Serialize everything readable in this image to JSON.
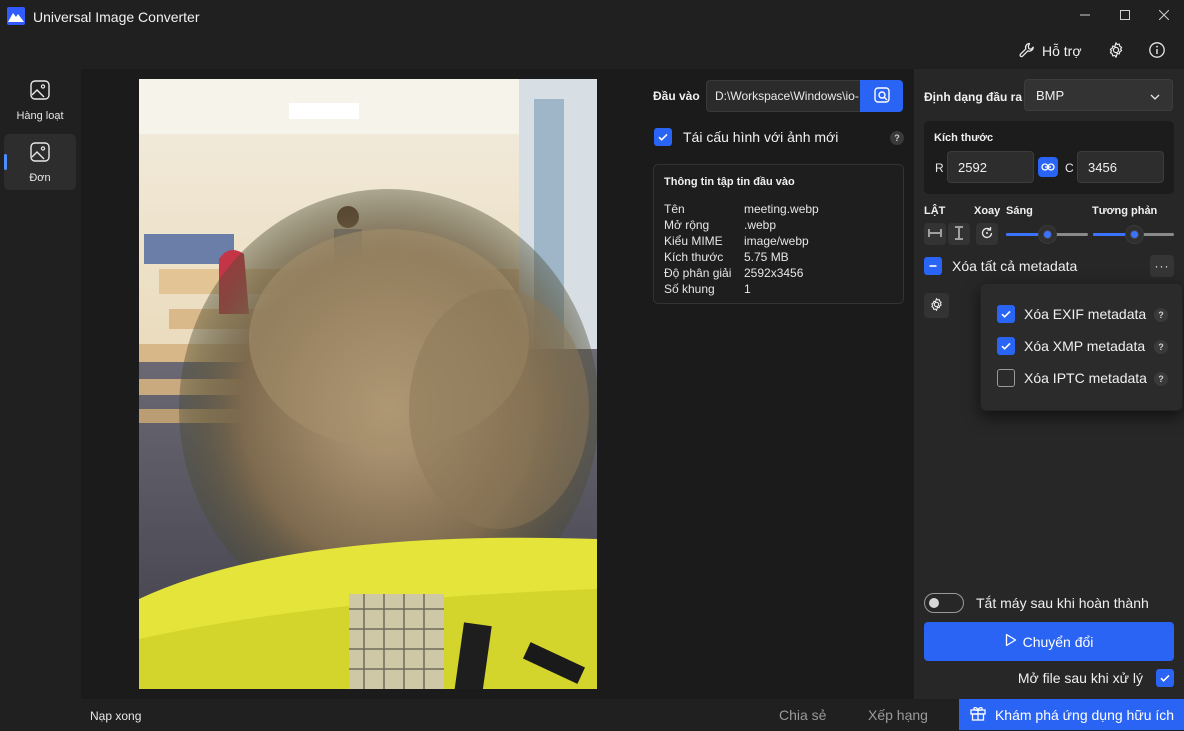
{
  "app": {
    "title": "Universal Image Converter"
  },
  "topbar": {
    "support_label": "Hỗ trợ"
  },
  "nav": [
    {
      "label": "Hàng loạt",
      "icon": "image-stack-icon"
    },
    {
      "label": "Đơn",
      "icon": "image-icon"
    }
  ],
  "input": {
    "label": "Đầu vào",
    "path": "D:\\Workspace\\Windows\\io-",
    "reconfig_label": "Tái cấu hình với ảnh mới",
    "help": "?"
  },
  "file_info": {
    "title": "Thông tin tập tin đầu vào",
    "rows": [
      {
        "key": "Tên",
        "value": "meeting.webp"
      },
      {
        "key": "Mở rộng",
        "value": ".webp"
      },
      {
        "key": "Kiểu MIME",
        "value": "image/webp"
      },
      {
        "key": "Kích thước",
        "value": "5.75 MB"
      },
      {
        "key": "Độ phân giải",
        "value": "2592x3456"
      },
      {
        "key": "Số khung",
        "value": "1"
      }
    ]
  },
  "output": {
    "format_label": "Định dạng đầu ra",
    "format_value": "BMP",
    "size_title": "Kích thước",
    "width_label": "R",
    "width_value": "2592",
    "height_label": "C",
    "height_value": "3456",
    "flip_label": "LẬT",
    "rotate_label": "Xoay",
    "brightness_label": "Sáng",
    "brightness_level": 0.5,
    "contrast_label": "Tương phản",
    "contrast_level": 0.5,
    "metadata_label": "Xóa tất cả metadata",
    "more_label": "···"
  },
  "metadata_popup": [
    {
      "label": "Xóa EXIF metadata",
      "checked": true
    },
    {
      "label": "Xóa XMP metadata",
      "checked": true
    },
    {
      "label": "Xóa IPTC metadata",
      "checked": false
    }
  ],
  "actions": {
    "shutdown_label": "Tắt máy sau khi hoàn thành",
    "shutdown_on": false,
    "convert_label": "Chuyển đổi",
    "open_after_label": "Mở file sau khi xử lý",
    "open_after_checked": true
  },
  "status": {
    "text": "Nạp xong",
    "share_label": "Chia sẻ",
    "rate_label": "Xếp hạng",
    "discover_label": "Khám phá ứng dụng hữu ích"
  },
  "colors": {
    "accent": "#2a64f5",
    "bg": "#202020",
    "panel": "#272727"
  }
}
